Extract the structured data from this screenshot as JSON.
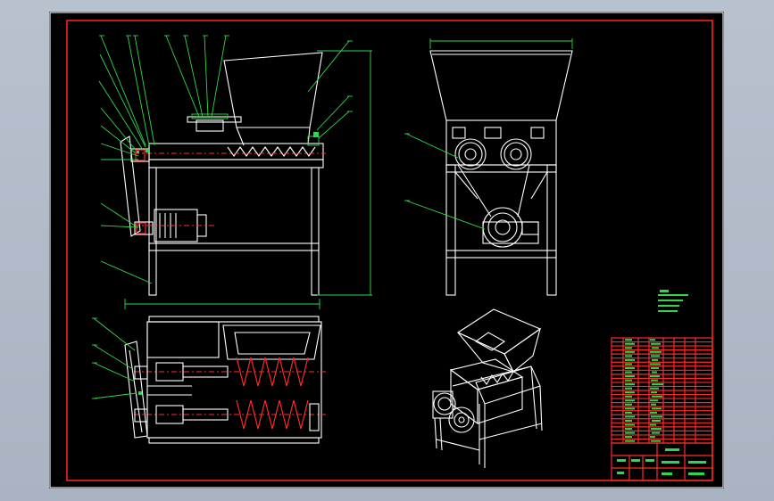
{
  "drawing": {
    "frame_color": "#ff2020",
    "background": "#000000",
    "line_color": "#ffffff",
    "leader_color": "#2fd84a"
  },
  "views": [
    {
      "name": "front-view"
    },
    {
      "name": "side-view"
    },
    {
      "name": "top-view"
    },
    {
      "name": "isometric-view"
    }
  ],
  "title_block": {
    "rows": 26,
    "drawing_no": "",
    "note_lines": 4
  }
}
